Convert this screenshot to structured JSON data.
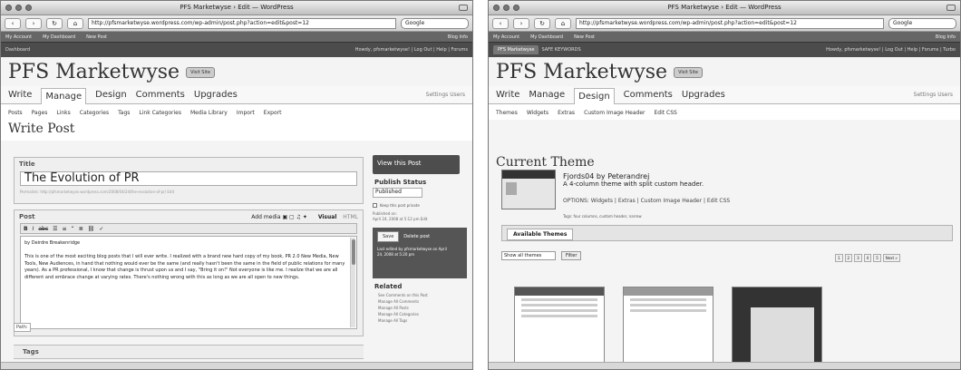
{
  "left_window": {
    "title": "PFS Marketwyse › Edit — WordPress",
    "url": "http://pfsmarketwyse.wordpress.com/wp-admin/post.php?action=edit&post=12",
    "search_placeholder": "Google",
    "adminbar": {
      "links": [
        "My Account",
        "My Dashboard",
        "New Post"
      ],
      "right": "Blog Info"
    },
    "header": {
      "left": "Dashboard",
      "right": "Howdy, pfsmarketwyse! | Log Out | Help | Forums"
    },
    "blog_title": "PFS Marketwyse",
    "visit_site": "Visit Site",
    "main_nav": [
      "Write",
      "Manage",
      "Design",
      "Comments",
      "Upgrades"
    ],
    "nav_side": "Settings  Users",
    "sub_nav": [
      "Posts",
      "Pages",
      "Links",
      "Categories",
      "Tags",
      "Link Categories",
      "Media Library",
      "Import",
      "Export"
    ],
    "page_title": "Write Post",
    "title_label": "Title",
    "title_value": "The Evolution of PR",
    "permalink": "Permalink: http://pfsmarketwyse.wordpress.com/2008/04/24/the-evolution-of-pr/ Edit",
    "post_label": "Post",
    "add_media": "Add media",
    "visual": "Visual",
    "html": "HTML",
    "editor_text": [
      "by Deirdre Breakenridge",
      "This is one of the most exciting blog posts that I will ever write. I realized with a brand new hard copy of my book, PR 2.0 New Media, New Tools, New Audiences, in hand that nothing would ever be the same (and really hasn't been the same in the field of public relations for many years). As a PR professional, I know that change is thrust upon us and I say, \"Bring it on!\" Not everyone is like me. I realize that we are all different and embrace change at varying rates. There's nothing wrong with this as long as we are all open to new things."
    ],
    "path": "Path:",
    "tags_label": "Tags",
    "view_post": "View this Post",
    "publish_status": "Publish Status",
    "status_value": "Published",
    "keep_private": "Keep this post private",
    "published_on": "Published on:",
    "published_date": "April 24, 2008 at 5:12 pm Edit",
    "save": "Save",
    "delete_post": "Delete post",
    "save_info": "Last edited by pfsmarketwyse on April 24, 2008 at 5:20 pm",
    "related": "Related",
    "related_items": [
      "See Comments on this Post",
      "Manage All Comments",
      "Manage All Posts",
      "Manage All Categories",
      "Manage All Tags"
    ]
  },
  "right_window": {
    "title": "PFS Marketwyse › Edit — WordPress",
    "url": "http://pfsmarketwyse.wordpress.com/wp-admin/post.php?action=edit&post=12",
    "search_placeholder": "Google",
    "adminbar": {
      "links": [
        "My Account",
        "My Dashboard",
        "New Post"
      ],
      "right": "Blog Info"
    },
    "header": {
      "tabs": [
        "PFS Marketwyse",
        "SAFE KEYWORDS"
      ],
      "right": "Howdy, pfsmarketwyse! | Log Out | Help | Forums | Turbo"
    },
    "blog_title": "PFS Marketwyse",
    "visit_site": "Visit Site",
    "main_nav": [
      "Write",
      "Manage",
      "Design",
      "Comments",
      "Upgrades"
    ],
    "nav_side": "Settings  Users",
    "sub_nav": [
      "Themes",
      "Widgets",
      "Extras",
      "Custom Image Header",
      "Edit CSS"
    ],
    "page_title": "Current Theme",
    "theme_name": "Fjords04 by Peterandrej",
    "theme_desc": "A 4-column theme with split custom header.",
    "theme_options": "OPTIONS: Widgets | Extras | Custom Image Header | Edit CSS",
    "tags": "Tags: four columns, custom header, narrow",
    "available_themes": "Available Themes",
    "show_all": "Show all themes",
    "filter": "Filter",
    "pager": [
      "1",
      "2",
      "3",
      "4",
      "5",
      "Next »"
    ]
  }
}
